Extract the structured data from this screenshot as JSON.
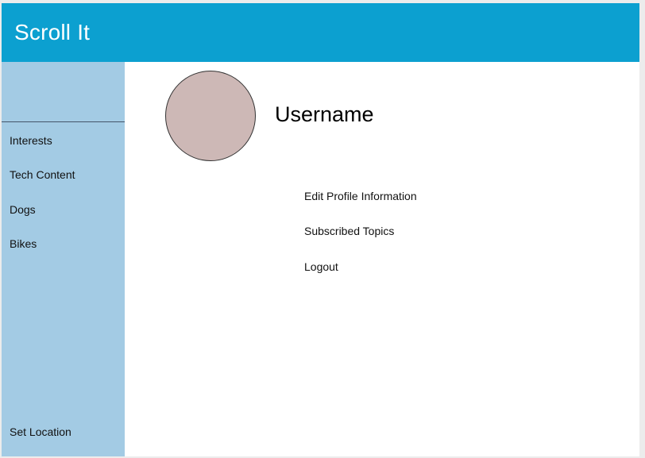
{
  "header": {
    "title": "Scroll It"
  },
  "sidebar": {
    "items": [
      {
        "label": "Interests"
      },
      {
        "label": "Tech Content"
      },
      {
        "label": "Dogs"
      },
      {
        "label": "Bikes"
      }
    ],
    "footer_label": "Set Location"
  },
  "profile": {
    "username": "Username",
    "avatar_color": "#cdb8b6",
    "menu": [
      {
        "label": "Edit Profile Information"
      },
      {
        "label": "Subscribed Topics"
      },
      {
        "label": "Logout"
      }
    ]
  },
  "colors": {
    "header_bg": "#0ca0d0",
    "sidebar_bg": "#a3cbe4"
  }
}
